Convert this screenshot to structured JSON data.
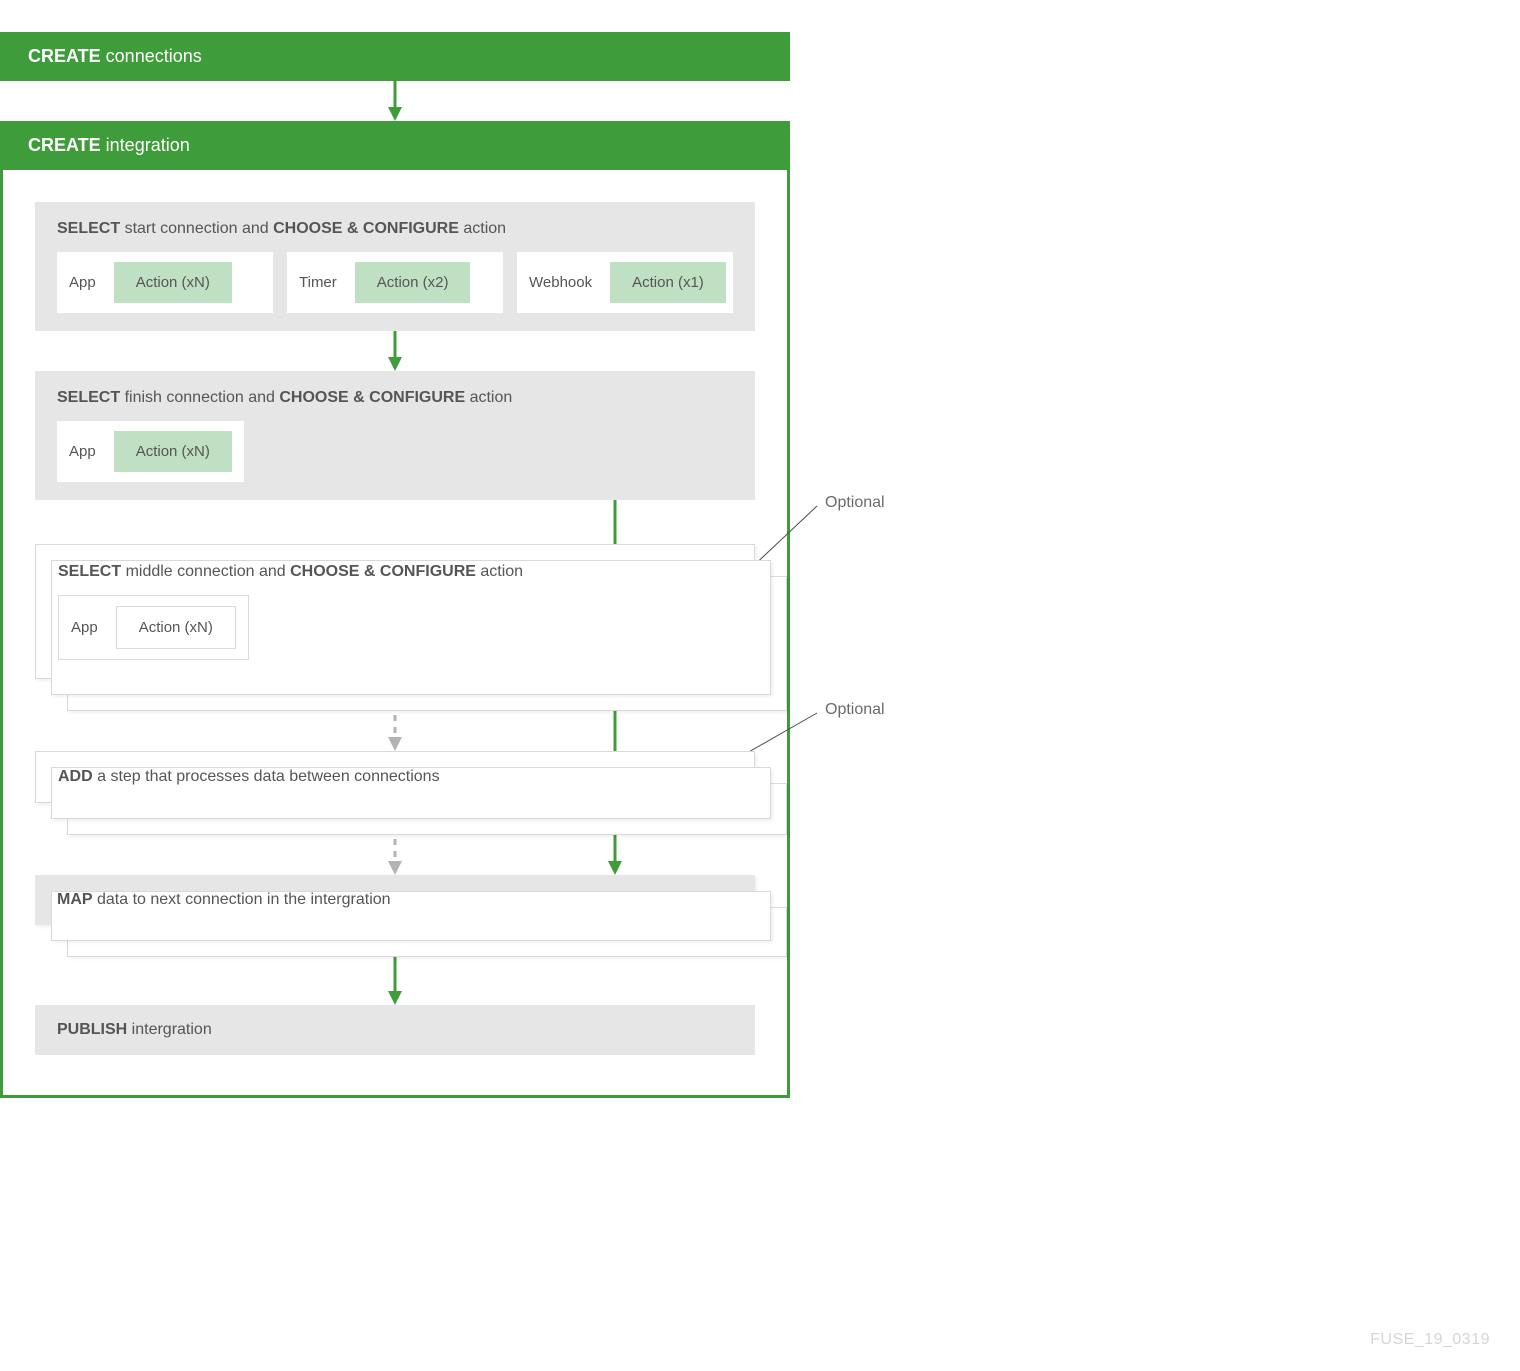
{
  "colors": {
    "green": "#3e9c3a",
    "green_light": "#bfe0c3",
    "gray_bg": "#e6e6e6"
  },
  "header1": {
    "bold": "CREATE",
    "rest": " connections"
  },
  "header2": {
    "bold": "CREATE",
    "rest": " integration"
  },
  "step1": {
    "title_parts": [
      "SELECT",
      " start connection and ",
      "CHOOSE & CONFIGURE",
      " action"
    ],
    "cards": [
      {
        "label": "App",
        "action": "Action (xN)"
      },
      {
        "label": "Timer",
        "action": "Action (x2)"
      },
      {
        "label": "Webhook",
        "action": "Action (x1)"
      }
    ]
  },
  "step2": {
    "title_parts": [
      "SELECT",
      " finish connection and ",
      "CHOOSE & CONFIGURE",
      " action"
    ],
    "card": {
      "label": "App",
      "action": "Action (xN)"
    }
  },
  "step3": {
    "title_parts": [
      "SELECT",
      " middle connection and ",
      "CHOOSE & CONFIGURE",
      " action"
    ],
    "card": {
      "label": "App",
      "action": "Action (xN)"
    },
    "callout": "Optional"
  },
  "step4": {
    "title_parts": [
      "ADD",
      " a step that processes data between connections"
    ],
    "callout": "Optional"
  },
  "step5": {
    "title_parts": [
      "MAP",
      " data to next connection in the intergration"
    ]
  },
  "step6": {
    "title_parts": [
      "PUBLISH",
      " intergration"
    ]
  },
  "footer_id": "FUSE_19_0319"
}
